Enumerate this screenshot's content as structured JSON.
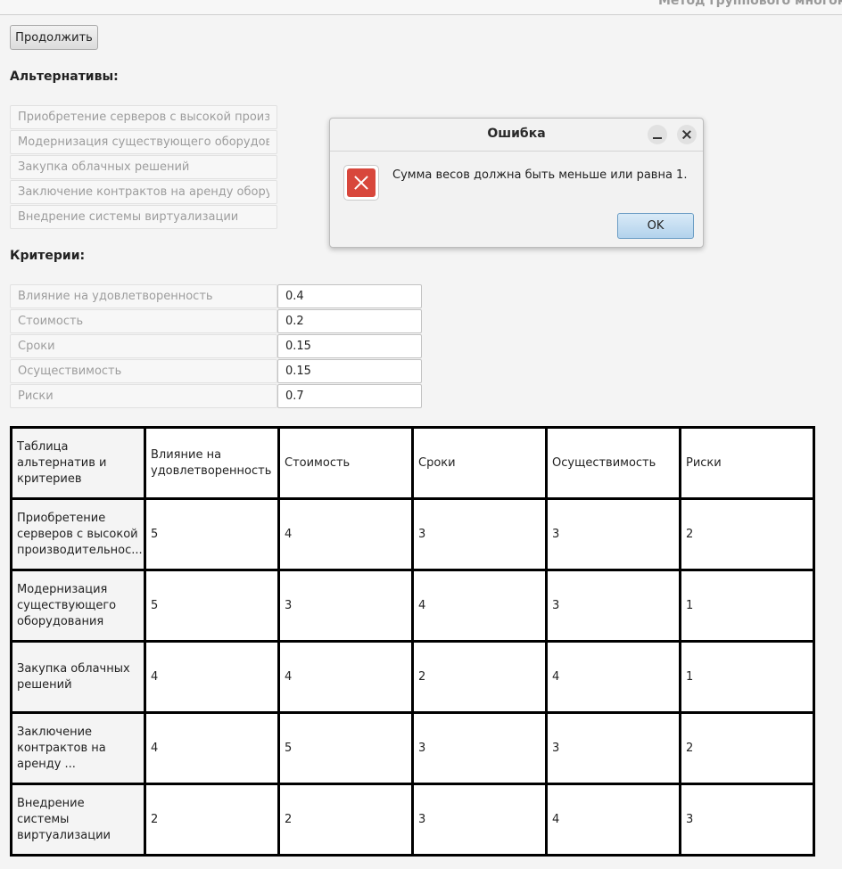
{
  "window": {
    "title": "Метод группового многокрит"
  },
  "toolbar": {
    "continue_label": "Продолжить"
  },
  "alternatives": {
    "heading": "Альтернативы:",
    "items": [
      "Приобретение серверов с высокой производительностью",
      "Модернизация существующего оборудования",
      "Закупка облачных решений",
      "Заключение контрактов на аренду оборудования",
      "Внедрение системы виртуализации"
    ]
  },
  "criteria": {
    "heading": "Критерии:",
    "items": [
      {
        "name": "Влияние на удовлетворенность",
        "weight": "0.4"
      },
      {
        "name": "Стоимость",
        "weight": "0.2"
      },
      {
        "name": "Сроки",
        "weight": "0.15"
      },
      {
        "name": "Осуществимость",
        "weight": "0.15"
      },
      {
        "name": "Риски",
        "weight": "0.7"
      }
    ]
  },
  "matrix": {
    "corner": "Таблица альтернатив и критериев",
    "columns": [
      "Влияние на удовлетворенность",
      "Стоимость",
      "Сроки",
      "Осуществимость",
      "Риски"
    ],
    "rows": [
      {
        "label": "Приобретение серверов с высокой производительнос...",
        "values": [
          "5",
          "4",
          "3",
          "3",
          "2"
        ]
      },
      {
        "label": "Модернизация существующего оборудования",
        "values": [
          "5",
          "3",
          "4",
          "3",
          "1"
        ]
      },
      {
        "label": "Закупка облачных решений",
        "values": [
          "4",
          "4",
          "2",
          "4",
          "1"
        ]
      },
      {
        "label": "Заключение контрактов на аренду ...",
        "values": [
          "4",
          "5",
          "3",
          "3",
          "2"
        ]
      },
      {
        "label": "Внедрение системы виртуализации",
        "values": [
          "2",
          "2",
          "3",
          "4",
          "3"
        ]
      }
    ]
  },
  "dialog": {
    "title": "Ошибка",
    "message": "Сумма весов должна быть меньше или равна 1.",
    "ok_label": "OK",
    "icon": "error-icon",
    "minimize_icon": "minimize-icon",
    "close_icon": "close-icon"
  },
  "colors": {
    "error_icon": "#d8473c",
    "ok_button": "#b2d2ec",
    "table_border": "#000000"
  }
}
